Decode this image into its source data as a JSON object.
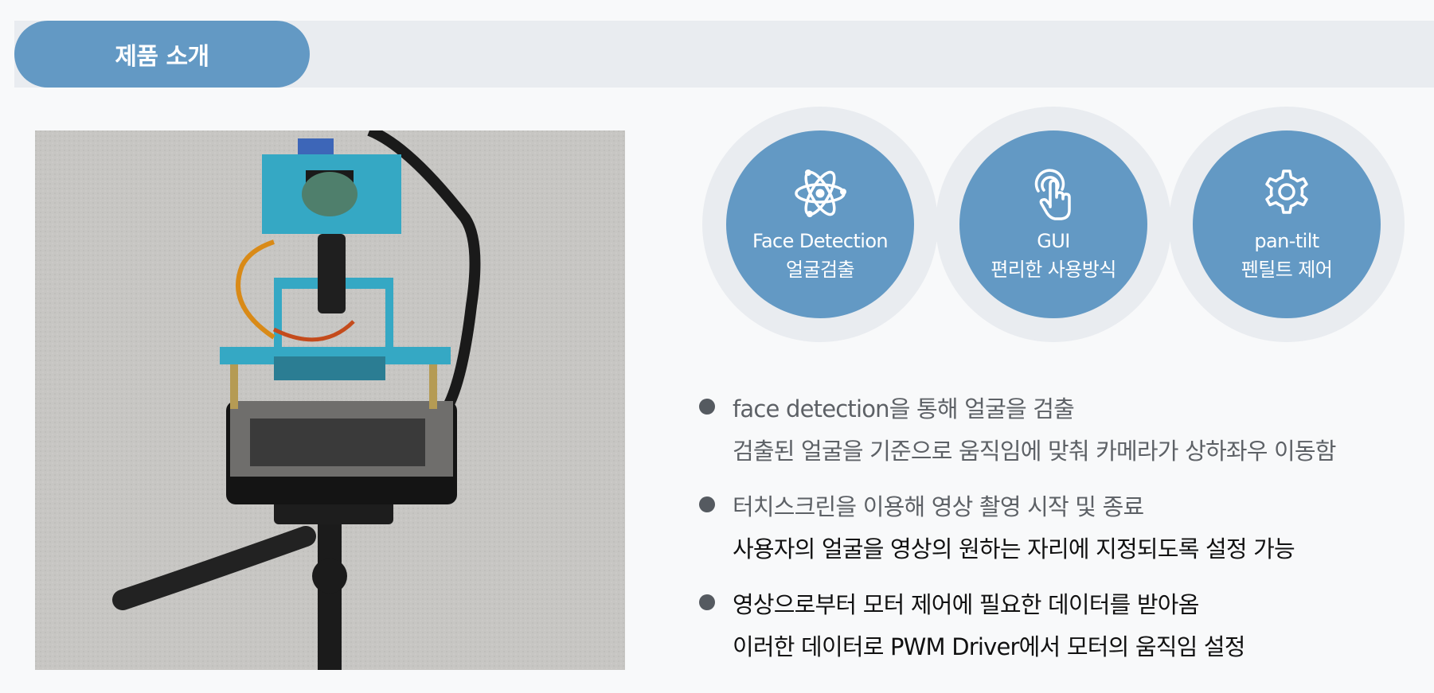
{
  "header": {
    "title": "제품 소개"
  },
  "features": [
    {
      "icon": "atom-icon",
      "title": "Face Detection",
      "subtitle": "얼굴검출"
    },
    {
      "icon": "touch-icon",
      "title": "GUI",
      "subtitle": "편리한 사용방식"
    },
    {
      "icon": "gear-icon",
      "title": "pan-tilt",
      "subtitle": "펜틸트 제어"
    }
  ],
  "bullets": [
    {
      "line1": "face detection을 통해 얼굴을 검출",
      "line2": "검출된 얼굴을 기준으로 움직임에 맞춰 카메라가 상하좌우 이동함"
    },
    {
      "line1": "터치스크린을 이용해 영상 촬영 시작 및 종료",
      "line2": "사용자의 얼굴을 영상의 원하는 자리에 지정되도록 설정 가능"
    },
    {
      "line1": "영상으로부터 모터 제어에 필요한 데이터를 받아옴",
      "line2": "이러한 데이터로 PWM Driver에서 모터의 움직임 설정"
    }
  ],
  "colors": {
    "accent": "#6399c4",
    "band": "#e9ecf0",
    "background": "#f8f9fa"
  }
}
